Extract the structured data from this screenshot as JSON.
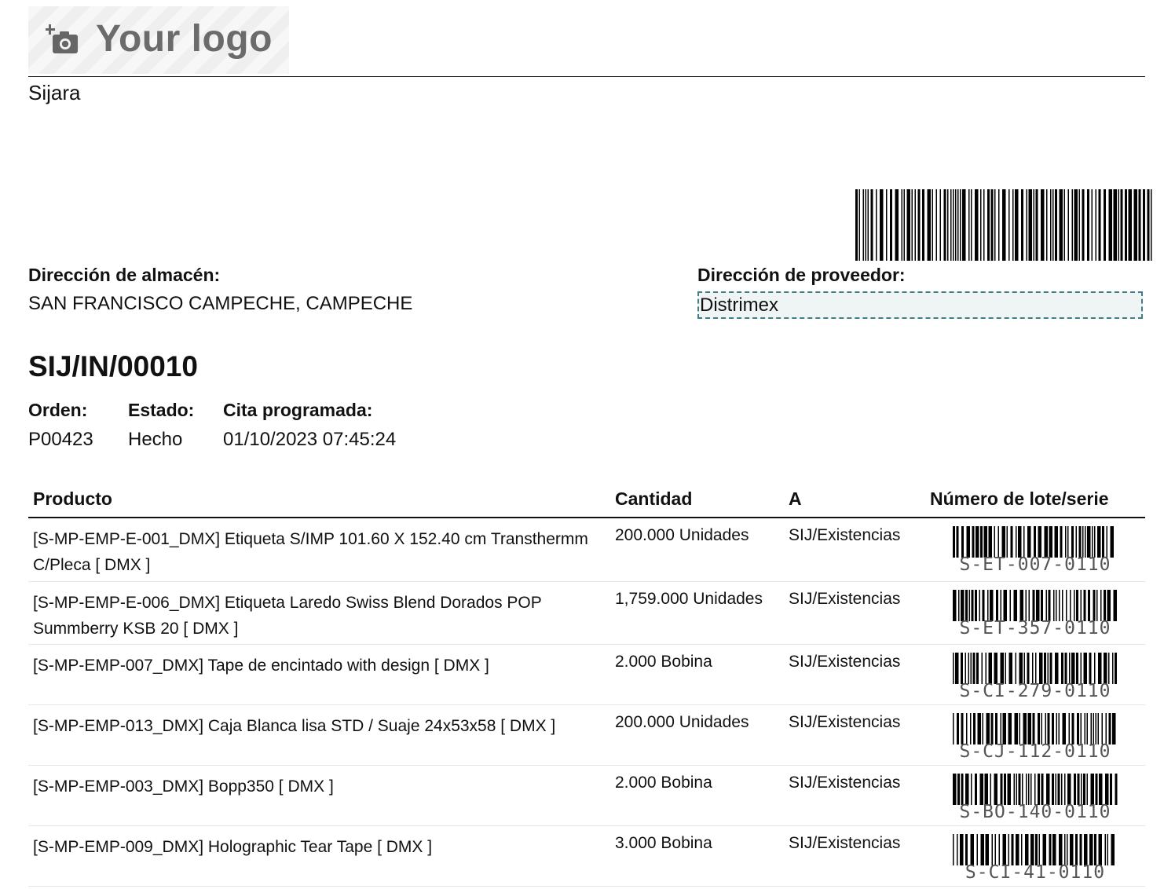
{
  "logo": {
    "text": "Your logo",
    "icon": "camera-plus-icon"
  },
  "company": "Sijara",
  "warehouse": {
    "label": "Dirección de almacén:",
    "address": "SAN FRANCISCO CAMPECHE, CAMPECHE"
  },
  "vendor": {
    "label": "Dirección de proveedor:",
    "name": "Distrimex"
  },
  "reference": "SIJ/IN/00010",
  "info": {
    "order_label": "Orden:",
    "order_value": "P00423",
    "state_label": "Estado:",
    "state_value": "Hecho",
    "scheduled_label": "Cita programada:",
    "scheduled_value": "01/10/2023 07:45:24"
  },
  "table": {
    "headers": [
      "Producto",
      "Cantidad",
      "A",
      "Número de lote/serie"
    ],
    "rows": [
      {
        "product": "[S-MP-EMP-E-001_DMX] Etiqueta S/IMP 101.60 X 152.40 cm Transthermm C/Pleca [ DMX ]",
        "qty": "200.000 Unidades",
        "to": "SIJ/Existencias",
        "lot": "S-ET-007-0110"
      },
      {
        "product": "[S-MP-EMP-E-006_DMX] Etiqueta Laredo Swiss Blend Dorados POP Summberry KSB 20 [ DMX ]",
        "qty": "1,759.000 Unidades",
        "to": "SIJ/Existencias",
        "lot": "S-ET-357-0110"
      },
      {
        "product": "[S-MP-EMP-007_DMX] Tape de encintado with design [ DMX ]",
        "qty": "2.000 Bobina",
        "to": "SIJ/Existencias",
        "lot": "S-CI-279-0110"
      },
      {
        "product": "[S-MP-EMP-013_DMX] Caja Blanca lisa STD / Suaje 24x53x58 [ DMX ]",
        "qty": "200.000 Unidades",
        "to": "SIJ/Existencias",
        "lot": "S-CJ-112-0110"
      },
      {
        "product": "[S-MP-EMP-003_DMX] Bopp350 [ DMX ]",
        "qty": "2.000 Bobina",
        "to": "SIJ/Existencias",
        "lot": "S-BO-140-0110"
      },
      {
        "product": "[S-MP-EMP-009_DMX] Holographic Tear Tape [ DMX ]",
        "qty": "3.000 Bobina",
        "to": "SIJ/Existencias",
        "lot": "S-CI-41-0110"
      }
    ]
  }
}
